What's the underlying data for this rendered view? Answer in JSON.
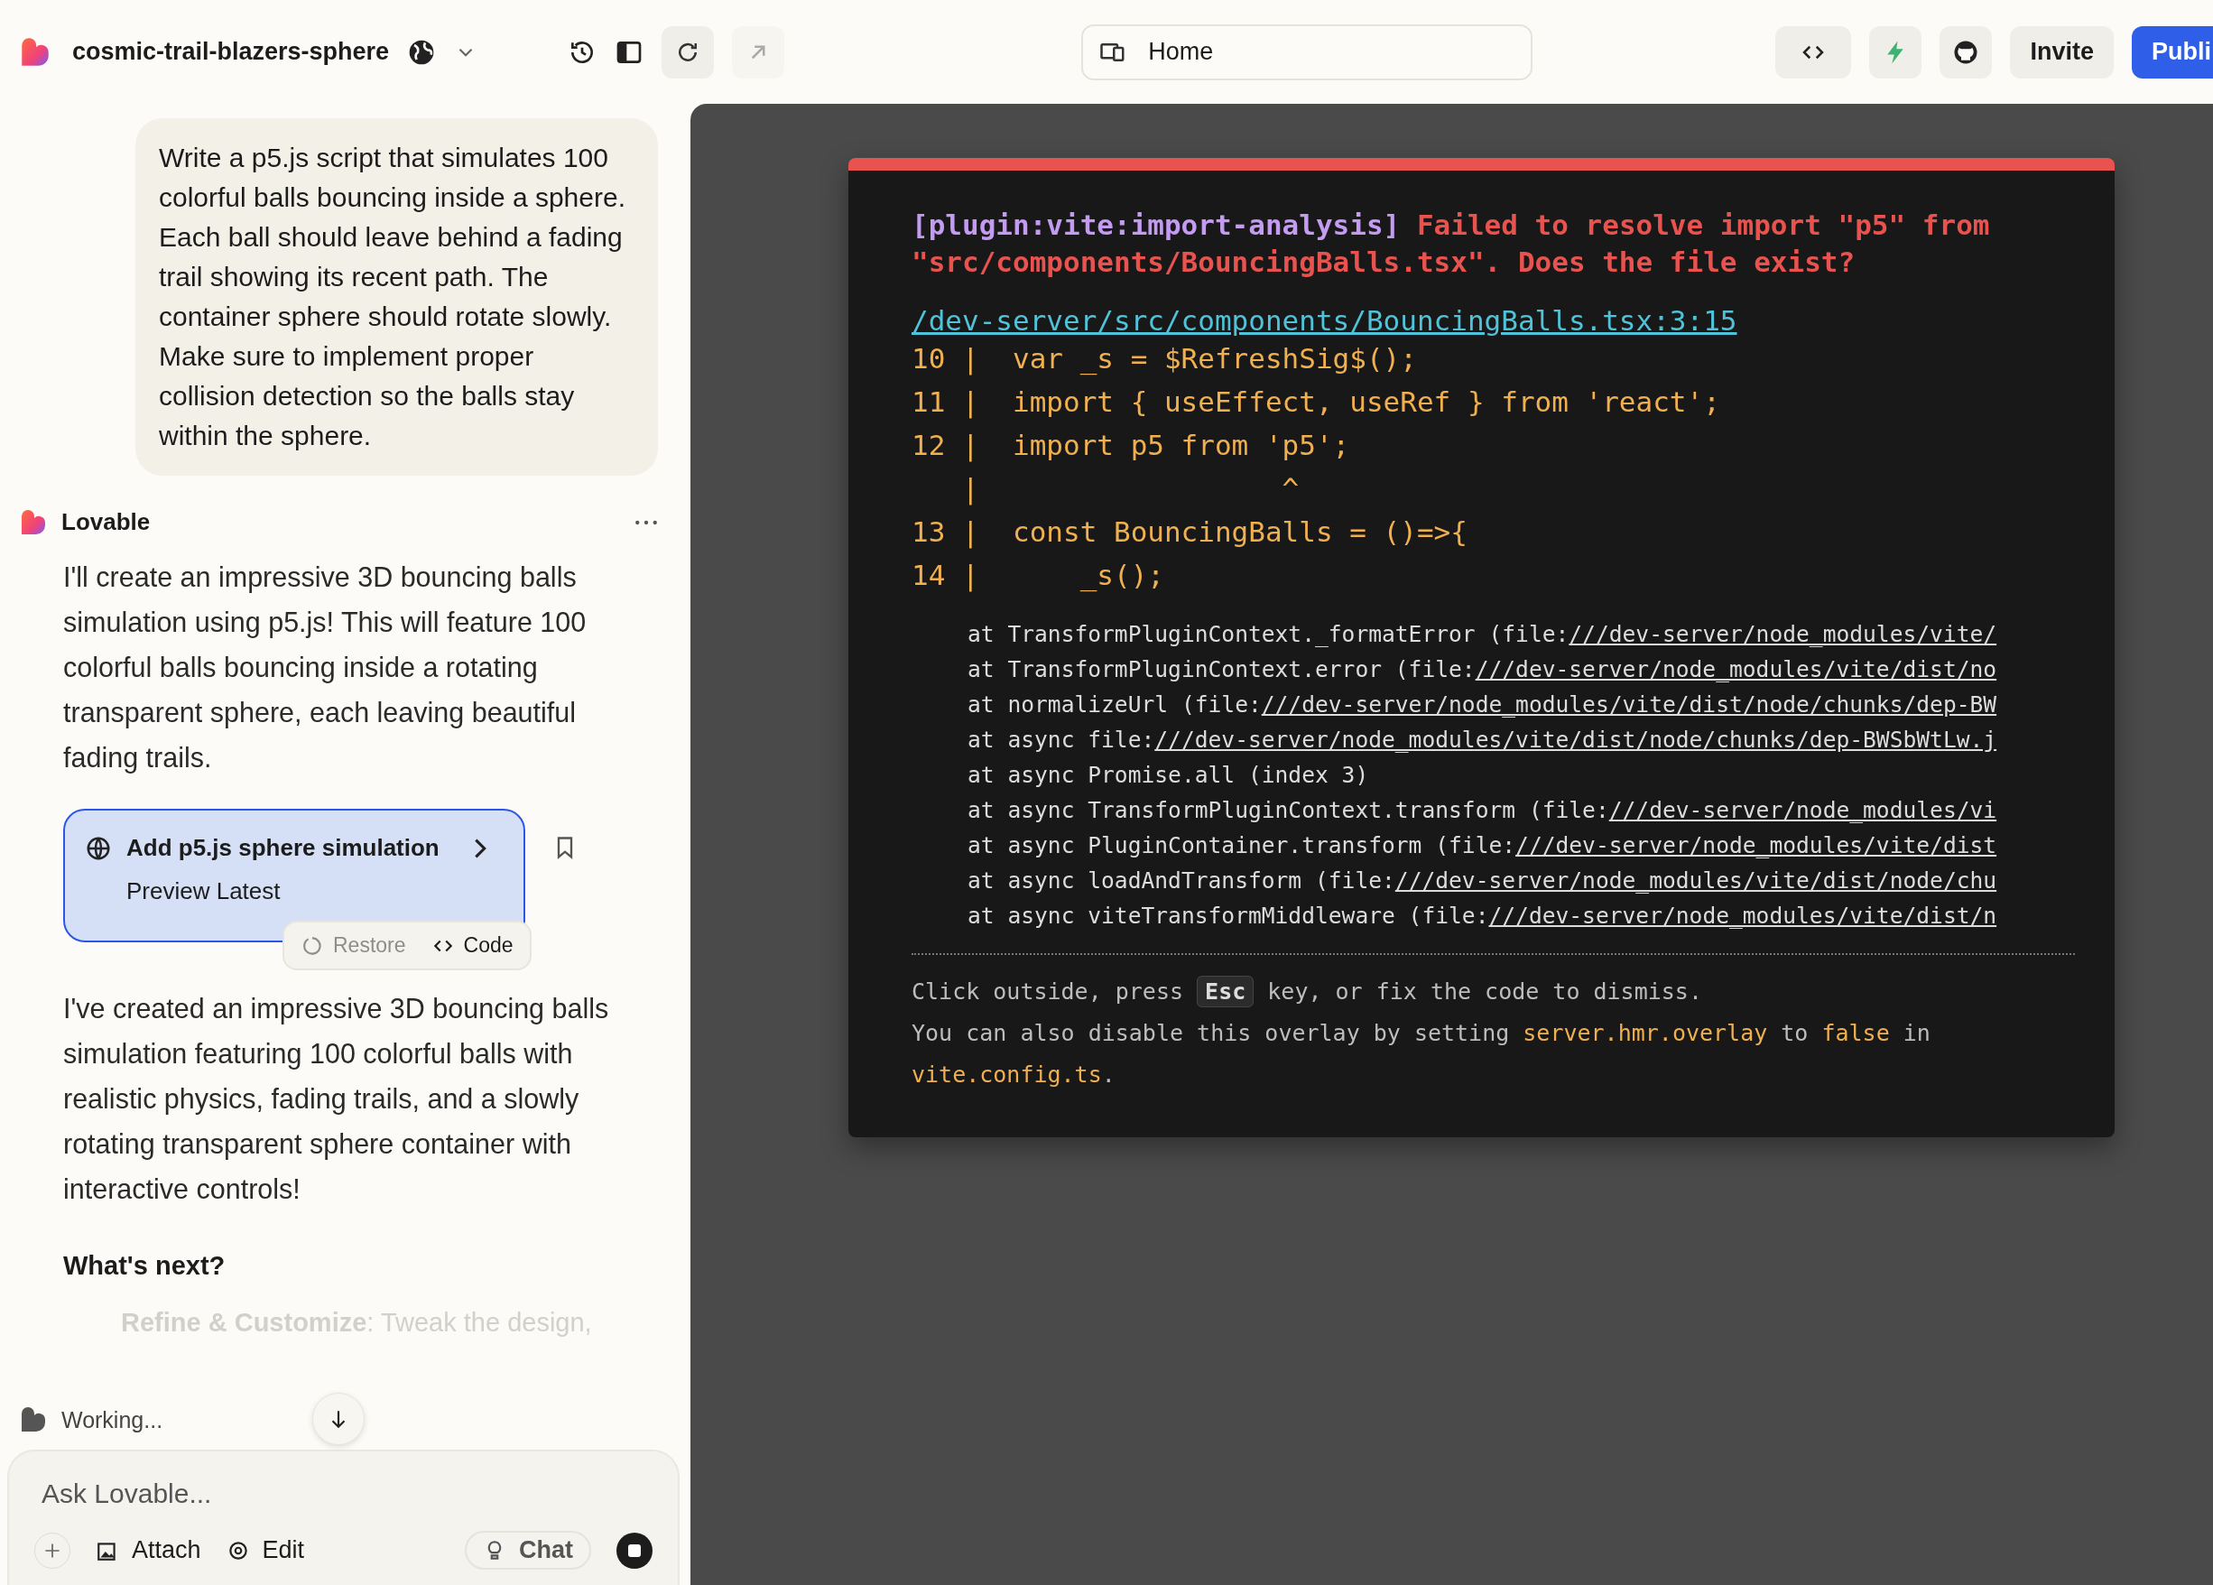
{
  "project": {
    "name": "cosmic-trail-blazers-sphere"
  },
  "toolbar": {
    "address": "Home",
    "buttons": [
      {
        "label": "Invite",
        "kind": "secondary"
      },
      {
        "label": "Publi",
        "kind": "primary"
      }
    ]
  },
  "chat": {
    "user_message": "Write a p5.js script that simulates 100 colorful balls bouncing inside a sphere. Each ball should leave behind a fading trail showing its recent path. The container sphere should rotate slowly. Make sure to implement proper collision detection so the balls stay within the sphere.",
    "assistant": "Lovable",
    "reply": "I'll create an impressive 3D bouncing balls simulation using p5.js! This will feature 100 colorful balls bouncing inside a rotating transparent sphere, each leaving beautiful fading trails.",
    "version_card": {
      "title": "Add p5.js sphere simulation",
      "subtitle": "Preview Latest",
      "actions": [
        {
          "label": "Restore",
          "kind": "restore",
          "disabled": true
        },
        {
          "label": "Code",
          "kind": "code",
          "disabled": false
        }
      ]
    },
    "summary": "I've created an impressive 3D bouncing balls simulation featuring 100 colorful balls with realistic physics, fading trails, and a slowly rotating transparent sphere container with interactive controls!",
    "heading": "What's next?",
    "bullet": "**Refine & Customize**: Tweak the design,",
    "status": "Working...",
    "composer": {
      "placeholder": "Ask Lovable...",
      "tools": [
        {
          "label": "Attach",
          "kind": "attach"
        },
        {
          "label": "Edit",
          "kind": "edit"
        },
        {
          "label": "Chat",
          "kind": "chat"
        }
      ]
    }
  },
  "error_overlay": {
    "plugin": "[plugin:vite:import-analysis]",
    "message": "Failed to resolve import \"p5\" from \"src/components/BouncingBalls.tsx\". Does the file exist?",
    "file": "/dev-server/src/components/BouncingBalls.tsx:3:15",
    "frame": [
      "10 |  var _s = $RefreshSig$();",
      "11 |  import { useEffect, useRef } from 'react';",
      "12 |  import p5 from 'p5';",
      "   |                  ^",
      "13 |  const BouncingBalls = ()=>{",
      "14 |      _s();"
    ],
    "stack": [
      {
        "text": "at TransformPluginContext._formatError (file:",
        "link": "///dev-server/node_modules/vite/"
      },
      {
        "text": "at TransformPluginContext.error (file:",
        "link": "///dev-server/node_modules/vite/dist/no"
      },
      {
        "text": "at normalizeUrl (file:",
        "link": "///dev-server/node_modules/vite/dist/node/chunks/dep-BW"
      },
      {
        "text": "at async file:",
        "link": "///dev-server/node_modules/vite/dist/node/chunks/dep-BWSbWtLw.j"
      },
      {
        "text": "at async Promise.all (index 3)"
      },
      {
        "text": "at async TransformPluginContext.transform (file:",
        "link": "///dev-server/node_modules/vi"
      },
      {
        "text": "at async PluginContainer.transform (file:",
        "link": "///dev-server/node_modules/vite/dist"
      },
      {
        "text": "at async loadAndTransform (file:",
        "link": "///dev-server/node_modules/vite/dist/node/chu"
      },
      {
        "text": "at async viteTransformMiddleware (file:",
        "link": "///dev-server/node_modules/vite/dist/n"
      }
    ],
    "tip": [
      [
        {
          "kind": "plain",
          "text": "Click outside, press "
        },
        {
          "kind": "key",
          "text": "Esc"
        },
        {
          "kind": "plain",
          "text": " key, or fix the code to dismiss."
        }
      ],
      [
        {
          "kind": "plain",
          "text": "You can also disable this overlay by setting "
        },
        {
          "kind": "code",
          "text": "server.hmr.overlay"
        },
        {
          "kind": "plain",
          "text": " to "
        },
        {
          "kind": "code",
          "text": "false"
        },
        {
          "kind": "plain",
          "text": " in"
        }
      ],
      [
        {
          "kind": "code",
          "text": "vite.config.ts"
        },
        {
          "kind": "plain",
          "text": "."
        }
      ]
    ]
  }
}
